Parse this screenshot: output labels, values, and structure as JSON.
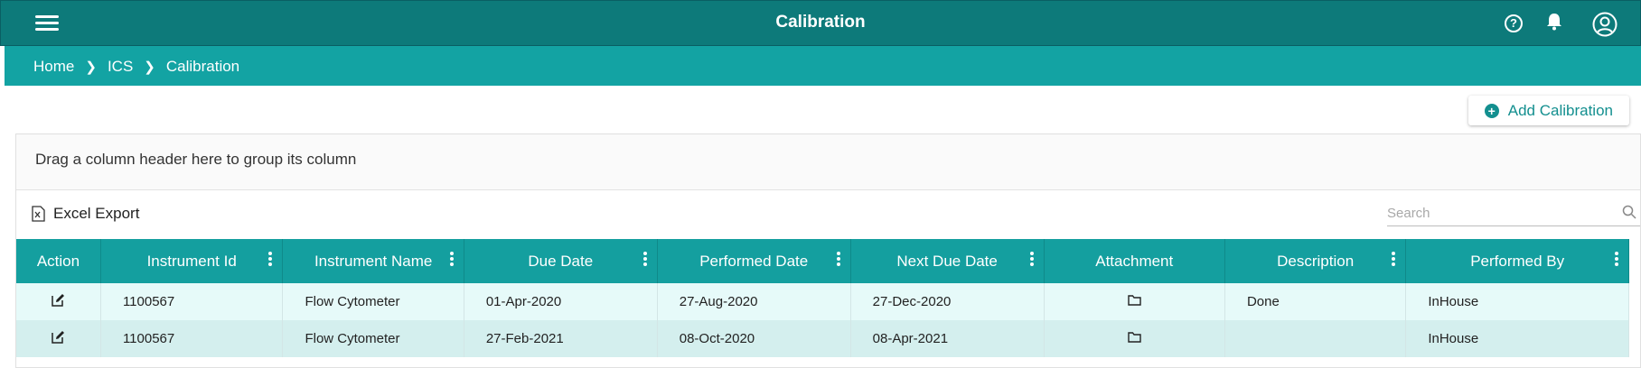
{
  "app": {
    "title": "Calibration"
  },
  "breadcrumb": [
    "Home",
    "ICS",
    "Calibration"
  ],
  "toolbar": {
    "add_label": "Add Calibration",
    "export_label": "Excel Export"
  },
  "group_panel": {
    "hint": "Drag a column header here to group its column"
  },
  "search": {
    "placeholder": "Search",
    "value": ""
  },
  "columns": [
    "Action",
    "Instrument Id",
    "Instrument Name",
    "Due Date",
    "Performed Date",
    "Next Due Date",
    "Attachment",
    "Description",
    "Performed By"
  ],
  "rows": [
    {
      "instrument_id": "1100567",
      "instrument_name": "Flow Cytometer",
      "due_date": "01-Apr-2020",
      "performed_date": "27-Aug-2020",
      "next_due_date": "27-Dec-2020",
      "description": "Done",
      "performed_by": "InHouse"
    },
    {
      "instrument_id": "1100567",
      "instrument_name": "Flow Cytometer",
      "due_date": "27-Feb-2021",
      "performed_date": "08-Oct-2020",
      "next_due_date": "08-Apr-2021",
      "description": "",
      "performed_by": "InHouse"
    }
  ],
  "icons": {
    "menu": "hamburger-menu-icon",
    "help": "help-circle-icon",
    "notifications": "bell-icon",
    "account": "user-circle-icon",
    "edit": "edit-icon",
    "attachment": "folder-icon",
    "export": "excel-file-icon",
    "search": "search-icon",
    "add": "plus-circle-icon"
  },
  "colors": {
    "header": "#0d7a7a",
    "breadcrumb_bar": "#13a3a3",
    "grid_header": "#149f9f",
    "row_odd": "#e6faf9",
    "row_even": "#d4efee",
    "accent": "#138f8f"
  }
}
